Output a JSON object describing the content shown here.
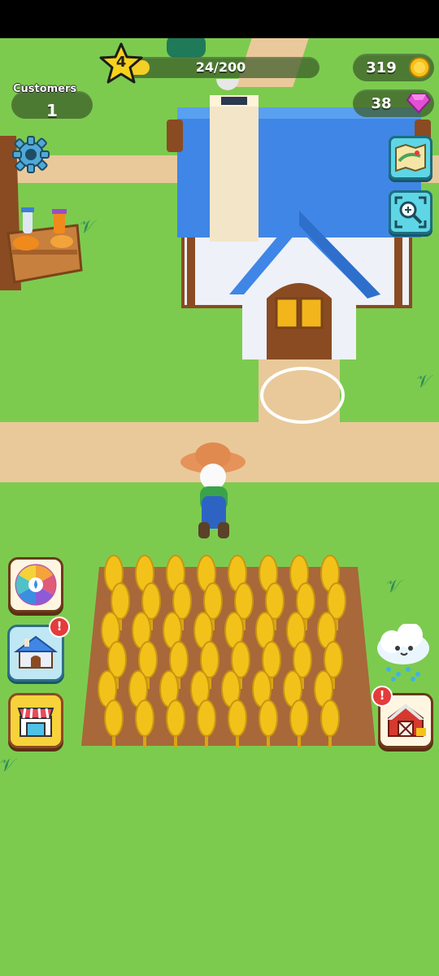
{
  "hud": {
    "level": "4",
    "xp_text": "24/200",
    "xp_progress": 0.12,
    "customers_label": "Customers",
    "customers_count": "1",
    "coins": "319",
    "gems": "38"
  },
  "icons": {
    "settings": "gear-icon",
    "map": "map-icon",
    "zoom": "zoom-icon",
    "spin_wheel": "spin-wheel-icon",
    "house_upgrade": "house-icon",
    "shop": "shop-icon",
    "barn": "barn-icon",
    "weather": "rain-cloud-icon"
  },
  "colors": {
    "grass": "#7ccb4f",
    "path": "#e9c99a",
    "roof": "#3f86e6",
    "field": "#a8683a",
    "wheat": "#f2c21b"
  },
  "alerts": {
    "house_alert": "!",
    "barn_alert": "!"
  }
}
